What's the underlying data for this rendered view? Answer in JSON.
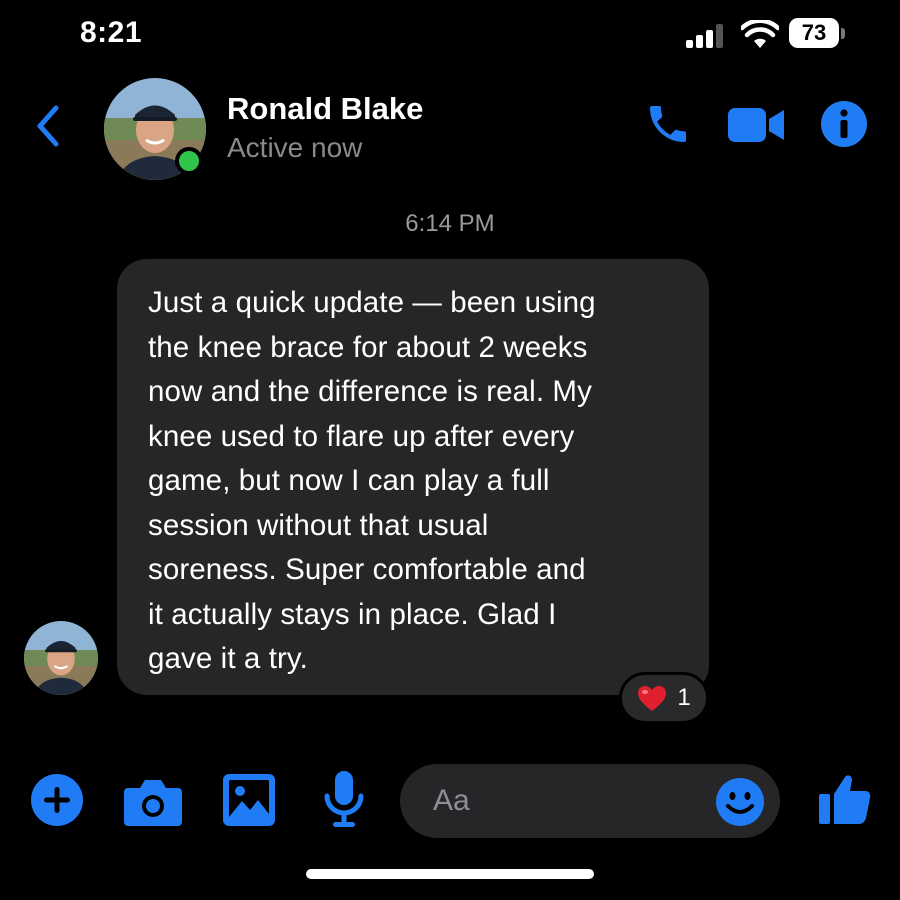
{
  "status_bar": {
    "time": "8:21",
    "battery": "73"
  },
  "header": {
    "contact_name": "Ronald Blake",
    "presence": "Active now",
    "icons": [
      "back-chevron-icon",
      "phone-icon",
      "video-camera-icon",
      "info-icon"
    ]
  },
  "conversation": {
    "timestamp": "6:14 PM",
    "messages": [
      {
        "lines": [
          "Just a quick update — been using",
          "the knee brace for about 2 weeks",
          "now and the difference is real. My",
          "knee used to flare up after every",
          "game, but now I can play a full",
          "session without that usual",
          "soreness. Super comfortable and",
          "it actually stays in place. Glad I",
          "gave it a try."
        ],
        "reaction": {
          "emoji": "heart-icon",
          "count": "1"
        }
      }
    ]
  },
  "composer": {
    "placeholder": "Aa",
    "icons": [
      "plus-icon",
      "camera-icon",
      "gallery-icon",
      "mic-icon",
      "emoji-icon",
      "thumbs-up-icon"
    ]
  },
  "colors": {
    "accent": "#1f7cf4",
    "bubble": "#262628",
    "online": "#31c44b",
    "background": "#000000"
  }
}
